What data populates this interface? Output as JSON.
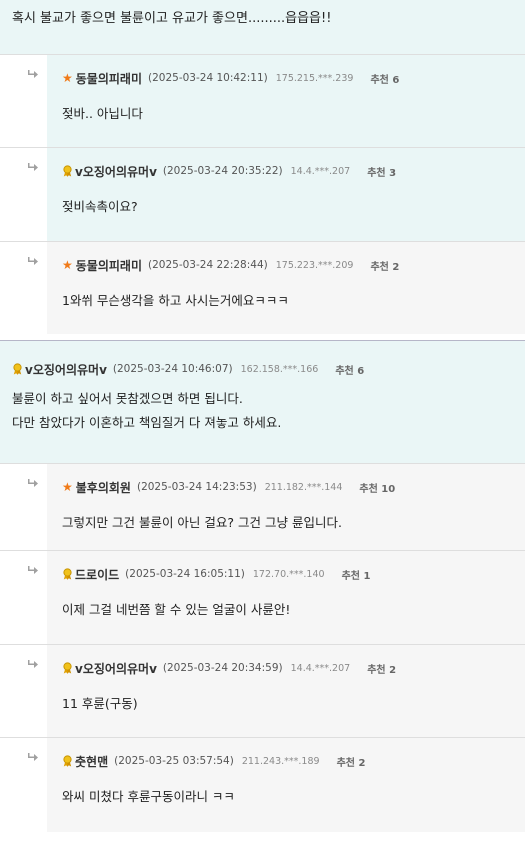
{
  "top": {
    "text": "혹시 불교가 좋으면 불륜이고 유교가 좋으면.........읍읍읍!!"
  },
  "replies1": [
    {
      "badge": "star",
      "nick": "동물의피래미",
      "date": "(2025-03-24 10:42:11)",
      "ip": "175.215.***.239",
      "rec": "추천 6",
      "text": "젖바.. 아닙니다",
      "bg": "blue"
    },
    {
      "badge": "medal",
      "nick": "v오징어의유머v",
      "date": "(2025-03-24 20:35:22)",
      "ip": "14.4.***.207",
      "rec": "추천 3",
      "text": "젖비속촉이요?",
      "bg": "blue"
    },
    {
      "badge": "star",
      "nick": "동물의피래미",
      "date": "(2025-03-24 22:28:44)",
      "ip": "175.223.***.209",
      "rec": "추천 2",
      "text": "1와쒸 무슨생각을 하고 사시는거에요ㅋㅋㅋ",
      "bg": "gray"
    }
  ],
  "main": {
    "nick": "v오징어의유머v",
    "date": "(2025-03-24 10:46:07)",
    "ip": "162.158.***.166",
    "rec": "추천 6",
    "line1": "불륜이 하고 싶어서 못참겠으면 하면 됩니다.",
    "line2": "다만 참았다가 이혼하고 책임질거 다 져놓고 하세요."
  },
  "replies2": [
    {
      "badge": "star",
      "nick": "불후의회원",
      "date": "(2025-03-24 14:23:53)",
      "ip": "211.182.***.144",
      "rec": "추천 10",
      "text": "그렇지만 그건 불륜이 아닌 걸요? 그건 그냥 륜입니다.",
      "bg": "gray"
    },
    {
      "badge": "medal",
      "nick": "드로이드",
      "date": "(2025-03-24 16:05:11)",
      "ip": "172.70.***.140",
      "rec": "추천 1",
      "text": "이제 그걸 네번쯤 할 수 있는 얼굴이 사륜안!",
      "bg": "gray"
    },
    {
      "badge": "medal",
      "nick": "v오징어의유머v",
      "date": "(2025-03-24 20:34:59)",
      "ip": "14.4.***.207",
      "rec": "추천 2",
      "text": "11 후륜(구동)",
      "bg": "gray"
    },
    {
      "badge": "medal",
      "nick": "춧현맨",
      "date": "(2025-03-25 03:57:54)",
      "ip": "211.243.***.189",
      "rec": "추천 2",
      "text": "와씨 미쳤다 후륜구동이라니 ㅋㅋ",
      "bg": "gray"
    }
  ],
  "colors": {
    "highlight_bg": "#eaf6f6",
    "reply_bg": "#f6f6f6",
    "star": "#f07a18",
    "medal": "#e8b800"
  }
}
